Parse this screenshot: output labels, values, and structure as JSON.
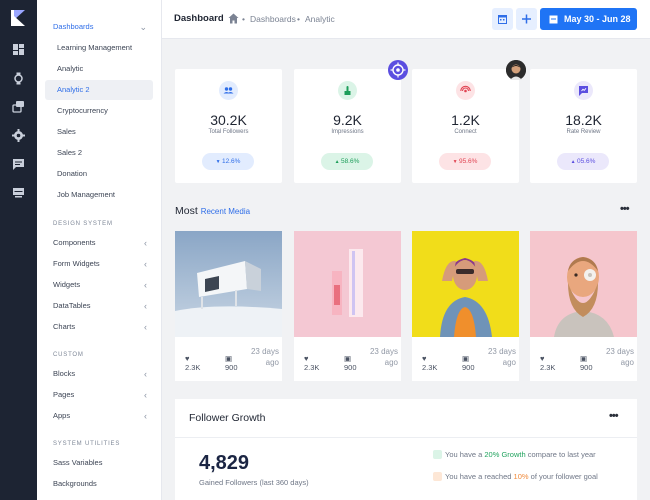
{
  "rail": {
    "logo": "brand-logo",
    "icons": [
      "dashboard-icon",
      "watch-icon",
      "layers-icon",
      "gear-icon",
      "chat-icon",
      "monitor-icon"
    ]
  },
  "sidebar": {
    "dashboards_label": "Dashboards",
    "dashboard_items": [
      "Learning Management",
      "Analytic",
      "Analytic 2",
      "Cryptocurrency",
      "Sales",
      "Sales 2",
      "Donation",
      "Job Management"
    ],
    "design_system_header": "DESIGN SYSTEM",
    "design_items": [
      "Components",
      "Form Widgets",
      "Widgets",
      "DataTables",
      "Charts"
    ],
    "custom_header": "CUSTOM",
    "custom_items": [
      "Blocks",
      "Pages",
      "Apps"
    ],
    "utilities_header": "SYSTEM UTILITIES",
    "utility_items": [
      "Sass Variables",
      "Backgrounds"
    ]
  },
  "topbar": {
    "title": "Dashboard",
    "crumb1": "Dashboards",
    "crumb2": "Analytic",
    "date_range": "May 30 - Jun 28"
  },
  "stats": [
    {
      "value": "30.2K",
      "label": "Total Followers",
      "change": "12.6%",
      "trend": "down",
      "color": "#2f6ee8",
      "icon": "users-icon"
    },
    {
      "value": "9.2K",
      "label": "Impressions",
      "change": "58.6%",
      "trend": "up",
      "color": "#1d9e5a",
      "icon": "pointer-icon"
    },
    {
      "value": "1.2K",
      "label": "Connect",
      "change": "95.6%",
      "trend": "down",
      "color": "#e14453",
      "icon": "broadcast-icon"
    },
    {
      "value": "18.2K",
      "label": "Rate Review",
      "change": "05.6%",
      "trend": "up",
      "color": "#5b4ee0",
      "icon": "rating-icon"
    }
  ],
  "media": {
    "title_prefix": "Most",
    "title_accent": "Recent Media",
    "items": [
      {
        "hearts": "2.3K",
        "comments": "900",
        "ago": "23 days ago"
      },
      {
        "hearts": "2.3K",
        "comments": "900",
        "ago": "23 days ago"
      },
      {
        "hearts": "2.3K",
        "comments": "900",
        "ago": "23 days ago"
      },
      {
        "hearts": "2.3K",
        "comments": "900",
        "ago": "23 days ago"
      }
    ]
  },
  "growth": {
    "title": "Follower Growth",
    "value": "4,829",
    "sub": "Gained Followers (last 360 days)",
    "line1_pre": "You have a",
    "line1_hl": "20% Growth",
    "line1_post": "compare to last year",
    "line2_pre": "You have a reached",
    "line2_hl": "10%",
    "line2_post": "of your follower goal"
  }
}
